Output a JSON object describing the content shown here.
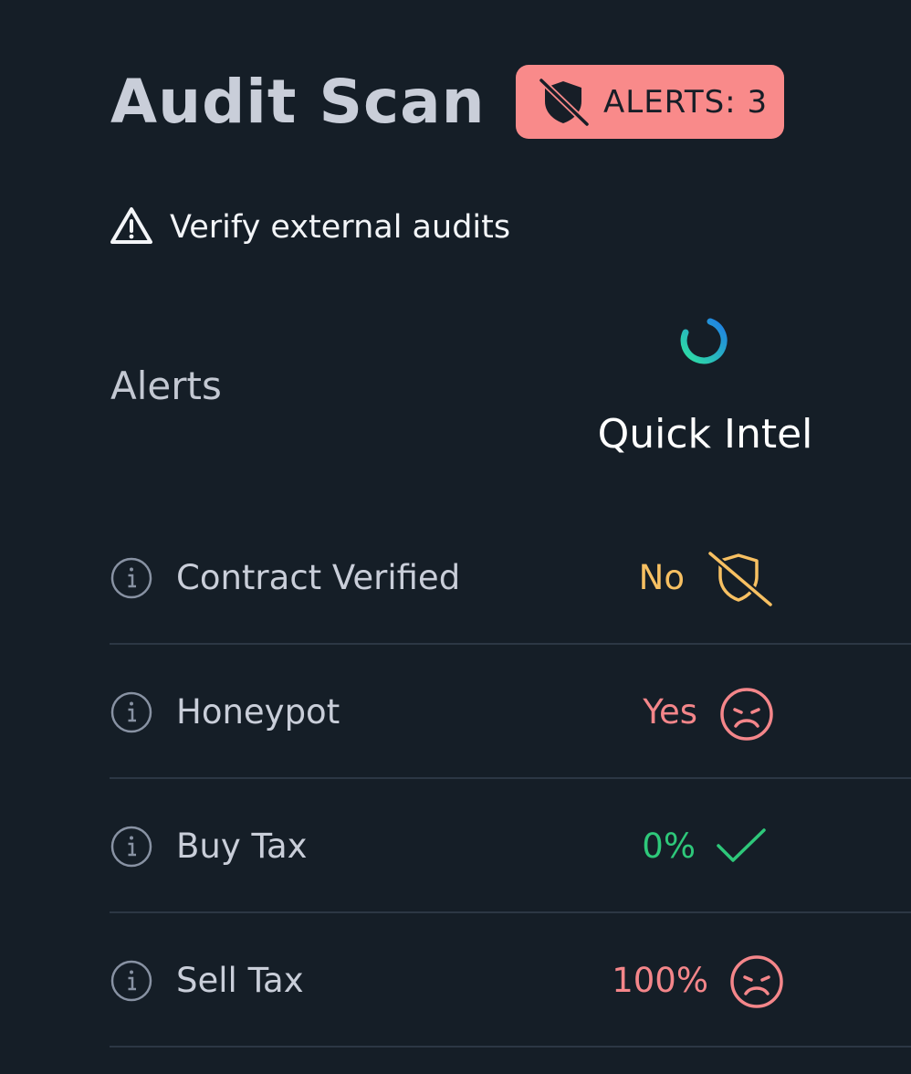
{
  "header": {
    "title": "Audit Scan",
    "alerts_badge": {
      "icon": "shield-off-icon",
      "text": "ALERTS: 3",
      "color": "#f98a8a"
    }
  },
  "warning": {
    "icon": "warning-triangle-icon",
    "text": "Verify external audits"
  },
  "table": {
    "heading": "Alerts",
    "provider": {
      "logo_icon": "quick-intel-logo-icon",
      "name": "Quick Intel"
    },
    "rows": [
      {
        "label": "Contract Verified",
        "value": "No",
        "status": "warning",
        "status_icon": "shield-off-icon",
        "color": "#f7c062"
      },
      {
        "label": "Honeypot",
        "value": "Yes",
        "status": "bad",
        "status_icon": "sad-face-icon",
        "color": "#f4868a"
      },
      {
        "label": "Buy Tax",
        "value": "0%",
        "status": "good",
        "status_icon": "check-icon",
        "color": "#2ec87a"
      },
      {
        "label": "Sell Tax",
        "value": "100%",
        "status": "bad",
        "status_icon": "sad-face-icon",
        "color": "#f4868a"
      }
    ]
  },
  "colors": {
    "background": "#151e27",
    "divider": "#2c3744",
    "info_icon": "#8892a3"
  }
}
